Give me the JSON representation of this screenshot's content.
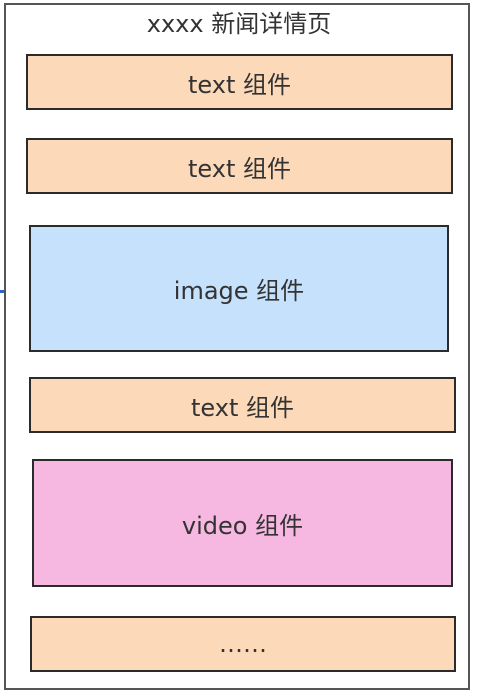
{
  "page": {
    "title": "xxxx 新闻详情页"
  },
  "blocks": [
    {
      "type": "text",
      "label": "text 组件"
    },
    {
      "type": "text",
      "label": "text 组件"
    },
    {
      "type": "image",
      "label": "image 组件"
    },
    {
      "type": "text",
      "label": "text 组件"
    },
    {
      "type": "video",
      "label": "video 组件"
    },
    {
      "type": "text",
      "label": "……"
    }
  ],
  "colors": {
    "text_block": "#fcd9b8",
    "image_block": "#c6e1fb",
    "video_block": "#f6b8e1",
    "border": "#2b2b2b"
  }
}
